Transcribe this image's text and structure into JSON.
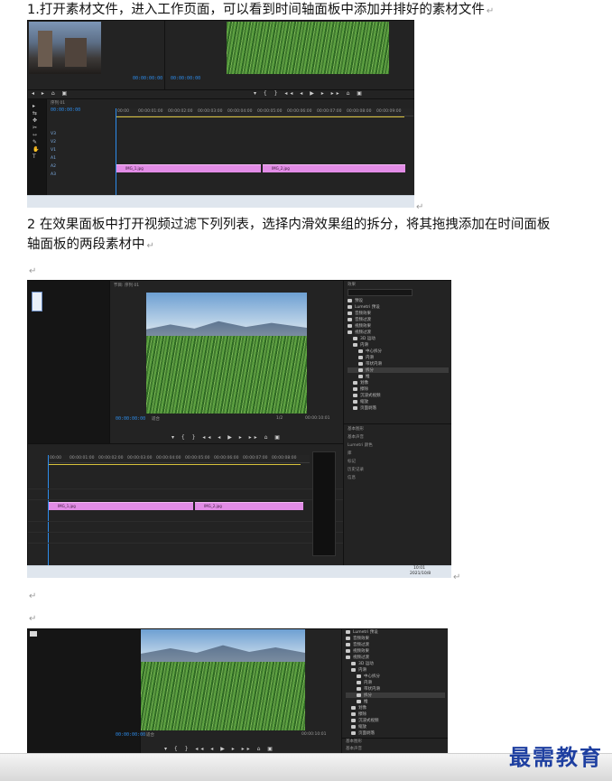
{
  "doc": {
    "step1": "1.打开素材文件，进入工作页面，可以看到时间轴面板中添加并排好的素材文件",
    "step2_line1": "2 在效果面板中打开视频过滤下列列表，选择内滑效果组的拆分，将其拖拽添加在时间面板",
    "step2_line2": "轴面板的两段素材中",
    "para_mark": "↵",
    "brand": "最需教育"
  },
  "shot1": {
    "tc_source": "00:00:00:00",
    "tc_program": "00:00:00:00",
    "tc_timeline": "00:00:00:00",
    "sequence_tab": "序列 01",
    "clip1": "IMG_1.jpg",
    "clip2": "IMG_2.jpg",
    "ruler": [
      "00:00",
      "00:00:01:00",
      "00:00:02:00",
      "00:00:03:00",
      "00:00:04:00",
      "00:00:05:00",
      "00:00:06:00",
      "00:00:07:00",
      "00:00:08:00",
      "00:00:09:00"
    ],
    "tracks": [
      "V3",
      "V2",
      "V1",
      "A1",
      "A2",
      "A3"
    ]
  },
  "shot2": {
    "program_tab": "节目: 序列 01",
    "tc_current": "00:00:00:00",
    "tc_duration": "00:00:10:01",
    "fit": "适合",
    "fraction": "1/2",
    "clip1": "IMG_1.jpg",
    "clip2": "IMG_2.jpg",
    "ruler": [
      "00:00",
      "00:00:01:00",
      "00:00:02:00",
      "00:00:03:00",
      "00:00:04:00",
      "00:00:05:00",
      "00:00:06:00",
      "00:00:07:00",
      "00:00:08:00"
    ],
    "effects_title": "效果",
    "effects": [
      "预设",
      "Lumetri 预设",
      "音频效果",
      "音频过渡",
      "视频效果",
      "视频过渡",
      "3D 运动",
      "内滑",
      "中心拆分",
      "内滑",
      "带状内滑",
      "拆分",
      "推",
      "划像",
      "擦除",
      "沉浸式视频",
      "缩放",
      "页面剥落"
    ],
    "effects_selected": "拆分",
    "side_panels": [
      "基本图形",
      "基本声音",
      "Lumetri 颜色",
      "库",
      "标记",
      "历史记录",
      "信息"
    ],
    "clock_time": "10:01",
    "clock_date": "2021/10/8"
  },
  "shot3": {
    "tc_current": "00:00:00:00",
    "tc_duration": "00:00:10:01",
    "fit": "适合",
    "effects": [
      "Lumetri 预设",
      "音频效果",
      "音频过渡",
      "视频效果",
      "视频过渡",
      "3D 运动",
      "内滑",
      "中心拆分",
      "内滑",
      "带状内滑",
      "拆分",
      "推",
      "划像",
      "擦除",
      "沉浸式视频",
      "缩放",
      "页面剥落"
    ],
    "effects_selected": "拆分",
    "side_panels": [
      "基本图形",
      "基本声音"
    ]
  }
}
